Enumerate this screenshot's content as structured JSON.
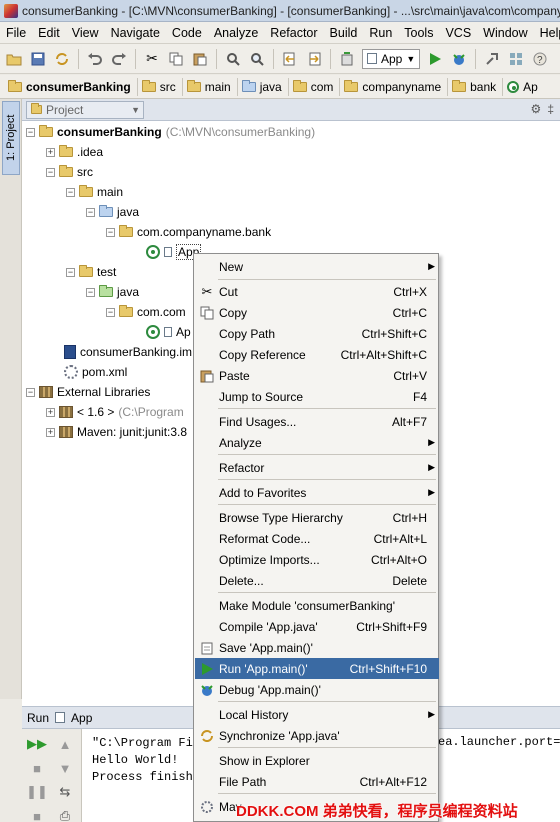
{
  "window": {
    "title": "consumerBanking - [C:\\MVN\\consumerBanking] - [consumerBanking] - ...\\src\\main\\java\\com\\companyn"
  },
  "menubar": [
    "File",
    "Edit",
    "View",
    "Navigate",
    "Code",
    "Analyze",
    "Refactor",
    "Build",
    "Run",
    "Tools",
    "VCS",
    "Window",
    "Help"
  ],
  "toolbar": {
    "run_config": "App"
  },
  "breadcrumb": [
    "consumerBanking",
    "src",
    "main",
    "java",
    "com",
    "companyname",
    "bank",
    "Ap"
  ],
  "sidebar": {
    "project_tab": "1: Project"
  },
  "project_panel": {
    "view_mode": "Project",
    "tree": {
      "root_label": "consumerBanking",
      "root_path": "(C:\\MVN\\consumerBanking)",
      "idea": ".idea",
      "src": "src",
      "main": "main",
      "main_java": "java",
      "main_package": "com.companyname.bank",
      "main_app": "App",
      "test": "test",
      "test_java": "java",
      "test_package": "com.com",
      "test_app": "Ap",
      "iml": "consumerBanking.im",
      "pom": "pom.xml",
      "ext_libs": "External Libraries",
      "jdk_label": "< 1.6 >",
      "jdk_path": "(C:\\Program",
      "junit": "Maven: junit:junit:3.8"
    }
  },
  "context_menu": {
    "items": [
      {
        "label": "New",
        "shortcut": "",
        "submenu": true,
        "icon": ""
      },
      {
        "label": "Cut",
        "shortcut": "Ctrl+X",
        "icon": "scissors-icon"
      },
      {
        "label": "Copy",
        "shortcut": "Ctrl+C",
        "icon": "copy-icon"
      },
      {
        "label": "Copy Path",
        "shortcut": "Ctrl+Shift+C",
        "icon": ""
      },
      {
        "label": "Copy Reference",
        "shortcut": "Ctrl+Alt+Shift+C",
        "icon": ""
      },
      {
        "label": "Paste",
        "shortcut": "Ctrl+V",
        "icon": "paste-icon"
      },
      {
        "label": "Jump to Source",
        "shortcut": "F4",
        "icon": ""
      },
      {
        "label": "Find Usages...",
        "shortcut": "Alt+F7",
        "icon": ""
      },
      {
        "label": "Analyze",
        "shortcut": "",
        "submenu": true,
        "icon": ""
      },
      {
        "label": "Refactor",
        "shortcut": "",
        "submenu": true,
        "icon": ""
      },
      {
        "label": "Add to Favorites",
        "shortcut": "",
        "submenu": true,
        "icon": ""
      },
      {
        "label": "Browse Type Hierarchy",
        "shortcut": "Ctrl+H",
        "icon": ""
      },
      {
        "label": "Reformat Code...",
        "shortcut": "Ctrl+Alt+L",
        "icon": ""
      },
      {
        "label": "Optimize Imports...",
        "shortcut": "Ctrl+Alt+O",
        "icon": ""
      },
      {
        "label": "Delete...",
        "shortcut": "Delete",
        "icon": ""
      },
      {
        "label": "Make Module 'consumerBanking'",
        "shortcut": "",
        "icon": ""
      },
      {
        "label": "Compile 'App.java'",
        "shortcut": "Ctrl+Shift+F9",
        "icon": ""
      },
      {
        "label": "Save 'App.main()'",
        "shortcut": "",
        "icon": "save-config-icon"
      },
      {
        "label": "Run 'App.main()'",
        "shortcut": "Ctrl+Shift+F10",
        "icon": "run-icon",
        "highlighted": true
      },
      {
        "label": "Debug 'App.main()'",
        "shortcut": "",
        "icon": "debug-icon"
      },
      {
        "label": "Local History",
        "shortcut": "",
        "submenu": true,
        "icon": ""
      },
      {
        "label": "Synchronize 'App.java'",
        "shortcut": "",
        "icon": "sync-icon"
      },
      {
        "label": "Show in Explorer",
        "shortcut": "",
        "icon": ""
      },
      {
        "label": "File Path",
        "shortcut": "Ctrl+Alt+F12",
        "icon": ""
      },
      {
        "label": "Mav",
        "shortcut": "",
        "icon": "maven-icon"
      }
    ]
  },
  "run_panel": {
    "tab_label": "Run",
    "config_label": "App",
    "console_lines": [
      "\"C:\\Program Fi",
      "Hello World!",
      "",
      "Process finish"
    ],
    "console_right": "ea.launcher.port=7"
  },
  "watermark": "DDKK.COM 弟弟快看，程序员编程资料站",
  "colors": {
    "highlight": "#3a6aa3",
    "run_green": "#2d9a2d",
    "watermark": "#e31010"
  }
}
